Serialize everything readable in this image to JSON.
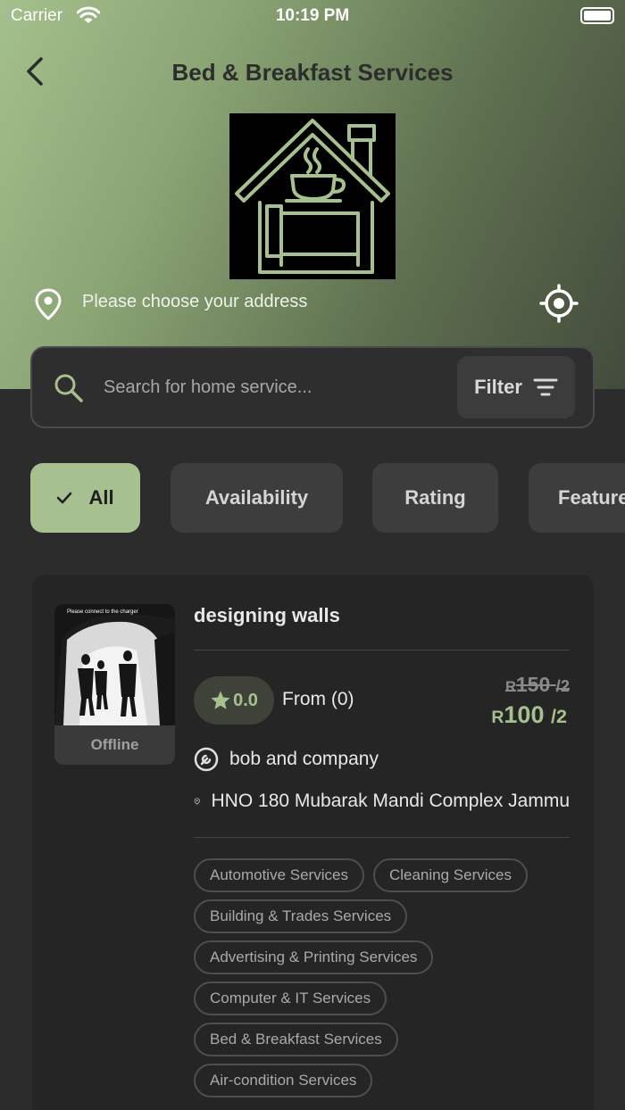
{
  "status_bar": {
    "carrier": "Carrier",
    "time": "10:19 PM"
  },
  "header": {
    "title": "Bed & Breakfast Services",
    "address_placeholder": "Please choose your address"
  },
  "search": {
    "placeholder": "Search for home service...",
    "filter_label": "Filter"
  },
  "filter_chips": [
    {
      "label": "All",
      "selected": true
    },
    {
      "label": "Availability",
      "selected": false
    },
    {
      "label": "Rating",
      "selected": false
    },
    {
      "label": "Featured",
      "selected": false
    }
  ],
  "service_card": {
    "name": "designing walls",
    "status": "Offline",
    "rating": "0.0",
    "from_text": "From (0)",
    "currency": "R",
    "old_price": "150",
    "new_price": "100",
    "per": "/2",
    "provider": "bob and company",
    "address": "HNO 180 Mubarak Mandi Complex Jammu",
    "photo_caption": "Please connect to the charger",
    "tags": [
      "Automotive Services",
      "Cleaning Services",
      "Building & Trades Services",
      "Advertising & Printing Services",
      "Computer & IT Services",
      "Bed & Breakfast Services",
      "Air-condition Services"
    ]
  },
  "colors": {
    "accent": "#a7c08f",
    "background": "#2c2c2c",
    "card": "#252525"
  }
}
